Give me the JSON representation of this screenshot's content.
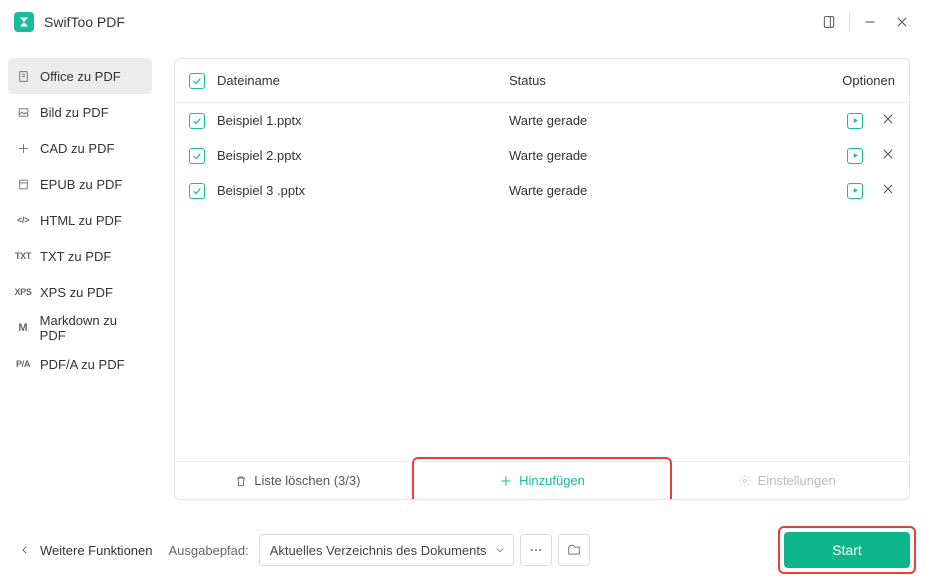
{
  "app_title": "SwifToo PDF",
  "sidebar": {
    "items": [
      {
        "label": "Office zu PDF",
        "icon": "office"
      },
      {
        "label": "Bild zu PDF",
        "icon": "image"
      },
      {
        "label": "CAD zu PDF",
        "icon": "cad"
      },
      {
        "label": "EPUB zu PDF",
        "icon": "epub"
      },
      {
        "label": "HTML zu PDF",
        "icon": "html"
      },
      {
        "label": "TXT zu PDF",
        "icon": "txt"
      },
      {
        "label": "XPS zu PDF",
        "icon": "xps"
      },
      {
        "label": "Markdown zu PDF",
        "icon": "md"
      },
      {
        "label": "PDF/A zu PDF",
        "icon": "pdfa"
      }
    ],
    "active_index": 0
  },
  "table": {
    "headers": {
      "name": "Dateiname",
      "status": "Status",
      "options": "Optionen"
    },
    "rows": [
      {
        "name": "Beispiel 1.pptx",
        "status": "Warte gerade"
      },
      {
        "name": "Beispiel 2.pptx",
        "status": "Warte gerade"
      },
      {
        "name": "Beispiel 3 .pptx",
        "status": "Warte gerade"
      }
    ],
    "footer": {
      "clear": "Liste löschen (3/3)",
      "add": "Hinzufügen",
      "settings": "Einstellungen"
    }
  },
  "bottom": {
    "back": "Weitere Funktionen",
    "output_label": "Ausgabepfad:",
    "output_value": "Aktuelles Verzeichnis des Dokuments",
    "start": "Start"
  }
}
